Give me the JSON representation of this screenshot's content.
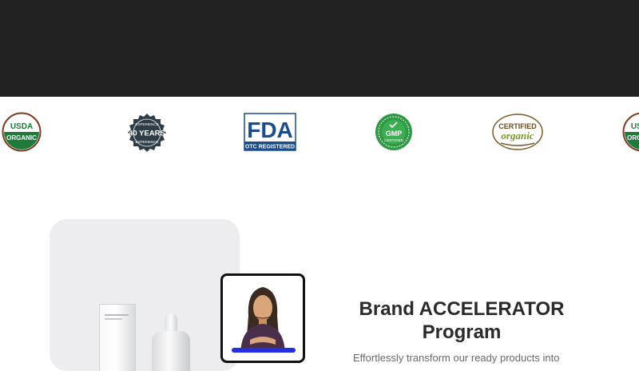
{
  "header": {
    "bg_color": "#222223"
  },
  "badges": {
    "usda": {
      "line1": "USDA",
      "line2": "ORGANIC"
    },
    "experience": {
      "top": "EXPERIENCE",
      "main": "40 YEARS",
      "bottom": "EXPERIENCE"
    },
    "fda": {
      "logo": "FDA",
      "sub": "OTC REGISTERED"
    },
    "gmp": {
      "main": "GMP",
      "sub": "CERTIFIED"
    },
    "organic": {
      "line1": "CERTIFIED",
      "line2": "organic"
    }
  },
  "main": {
    "title_line1": "Brand ACCELERATOR",
    "title_line2": "Program",
    "subtext": "Effortlessly transform our ready products into"
  },
  "colors": {
    "accent_blue": "#2430e0",
    "fda_blue": "#1b4c8c",
    "usda_green": "#1f7a3c"
  }
}
